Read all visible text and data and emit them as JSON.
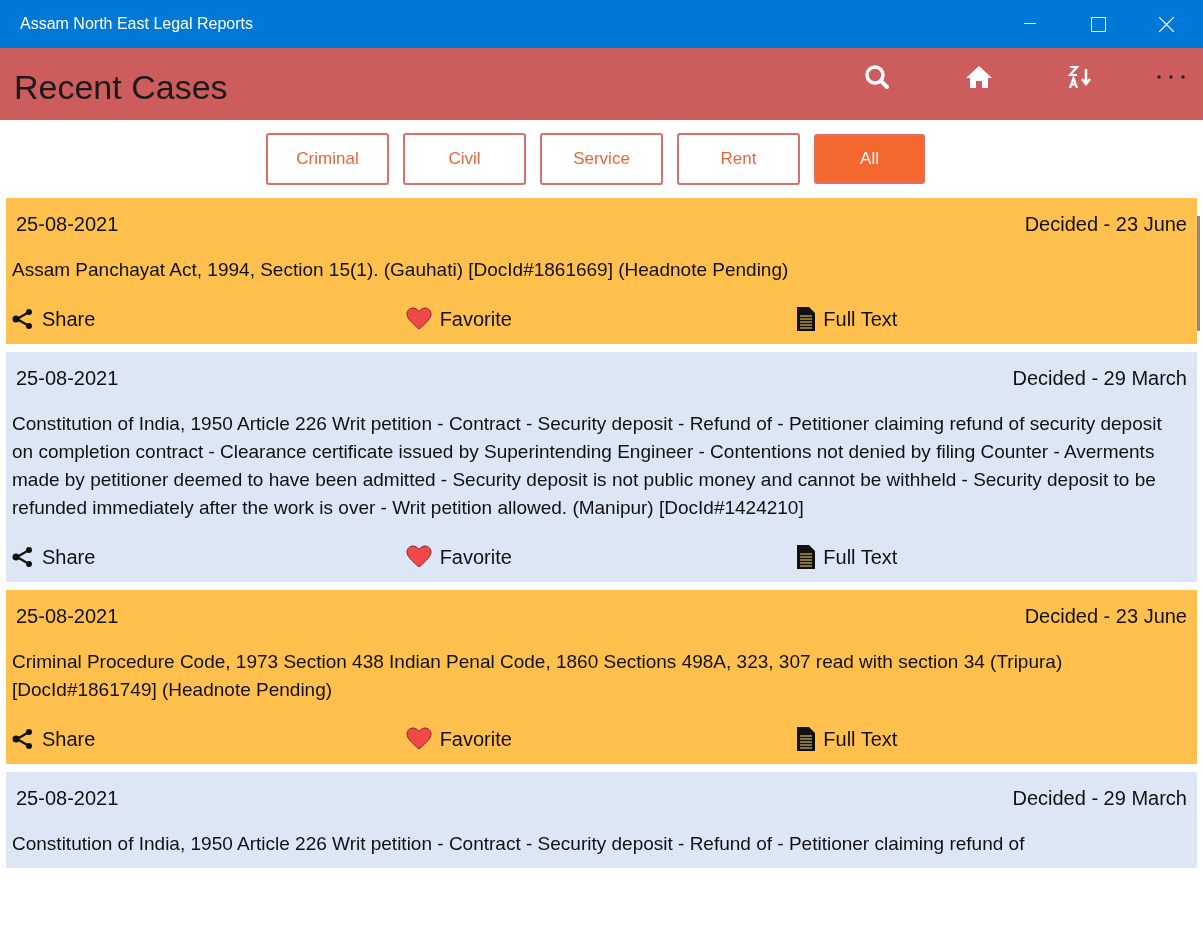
{
  "window": {
    "title": "Assam North East Legal Reports"
  },
  "header": {
    "title": "Recent Cases"
  },
  "filters": [
    {
      "label": "Criminal",
      "selected": false
    },
    {
      "label": "Civil",
      "selected": false
    },
    {
      "label": "Service",
      "selected": false
    },
    {
      "label": "Rent",
      "selected": false
    },
    {
      "label": "All",
      "selected": true
    }
  ],
  "cases": [
    {
      "date": "25-08-2021",
      "status": "Decided - 23 June",
      "color": "#ffc04d",
      "text": "Assam Panchayat Act, 1994, Section 15(1). (Gauhati) [DocId#1861669] (Headnote Pending)",
      "actions": [
        "Share",
        "Favorite",
        "Full Text"
      ]
    },
    {
      "date": "25-08-2021",
      "status": "Decided - 29 March",
      "color": "#dce6f5",
      "text": "Constitution of India, 1950 Article 226 Writ petition - Contract - Security deposit - Refund of - Petitioner claiming refund of security deposit on completion contract - Clearance certificate issued by Superintending Engineer - Contentions not denied by filing Counter - Averments made by petitioner deemed to have been admitted - Security deposit is not public money and cannot be withheld - Security deposit to be refunded immediately after the work is over - Writ petition allowed. (Manipur) [DocId#1424210]",
      "actions": [
        "Share",
        "Favorite",
        "Full Text"
      ]
    },
    {
      "date": "25-08-2021",
      "status": "Decided - 23 June",
      "color": "#ffc04d",
      "text": "Criminal Procedure Code, 1973 Section 438 Indian Penal Code, 1860 Sections 498A, 323, 307 read with section 34 (Tripura) [DocId#1861749] (Headnote Pending)",
      "actions": [
        "Share",
        "Favorite",
        "Full Text"
      ]
    },
    {
      "date": "25-08-2021",
      "status": "Decided - 29 March",
      "color": "#dce6f5",
      "text": "Constitution of India, 1950 Article 226 Writ petition - Contract - Security deposit - Refund of - Petitioner claiming refund of"
    }
  ]
}
